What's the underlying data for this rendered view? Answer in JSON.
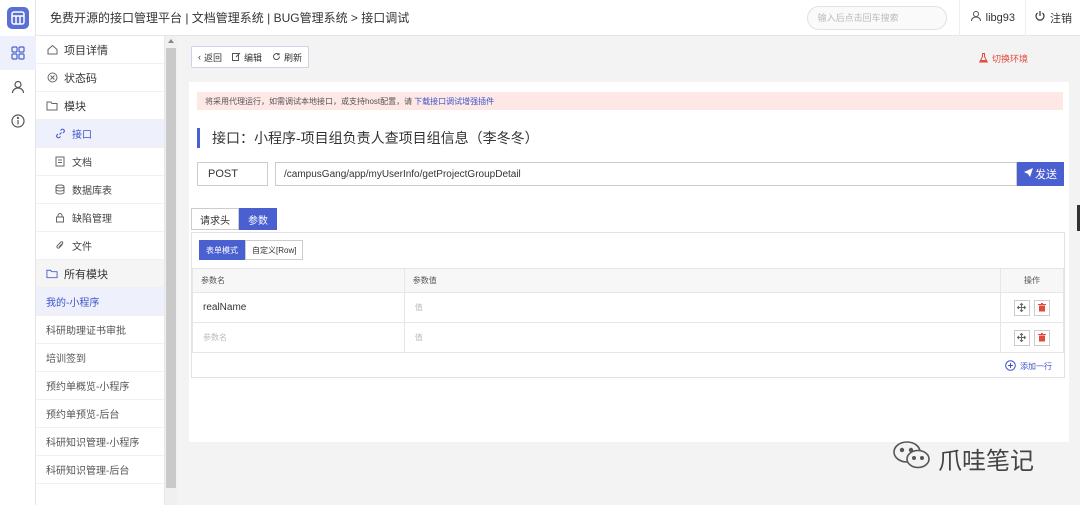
{
  "header": {
    "title": "免费开源的接口管理平台 | 文档管理系统 | BUG管理系统 > 接口调试",
    "search_placeholder": "输入后点击回车搜索",
    "username": "libg93",
    "logout": "注销"
  },
  "rail": {
    "icons": [
      "grid-icon",
      "user-icon",
      "info-icon"
    ]
  },
  "sidebar": {
    "items": [
      {
        "label": "项目详情"
      },
      {
        "label": "状态码"
      },
      {
        "label": "模块"
      },
      {
        "label": "接口"
      },
      {
        "label": "文档"
      },
      {
        "label": "数据库表"
      },
      {
        "label": "缺陷管理"
      },
      {
        "label": "文件"
      },
      {
        "label": "所有模块"
      }
    ],
    "modules": [
      {
        "label": "我的-小程序"
      },
      {
        "label": "科研助理证书审批"
      },
      {
        "label": "培训签到"
      },
      {
        "label": "预约单概览-小程序"
      },
      {
        "label": "预约单预览-后台"
      },
      {
        "label": "科研知识管理-小程序"
      },
      {
        "label": "科研知识管理-后台"
      }
    ]
  },
  "toolbar": {
    "back": "返回",
    "edit": "编辑",
    "refresh": "刷新",
    "switch_env": "切换环境"
  },
  "notice": {
    "text": "将采用代理运行，如需调试本地接口，或支持host配置，请",
    "link": "下载接口调试增强插件"
  },
  "api": {
    "title": "接口：小程序-项目组负责人查项目组信息（李冬冬）",
    "method": "POST",
    "url": "/campusGang/app/myUserInfo/getProjectGroupDetail",
    "send": "发送"
  },
  "tabs": [
    {
      "label": "请求头"
    },
    {
      "label": "参数"
    }
  ],
  "modes": [
    {
      "label": "表单模式"
    },
    {
      "label": "自定义[Row]"
    }
  ],
  "params": {
    "headers": {
      "name": "参数名",
      "value": "参数值",
      "op": "操作"
    },
    "rows": [
      {
        "name": "realName",
        "value_placeholder": "值"
      },
      {
        "name_placeholder": "参数名",
        "value_placeholder": "值"
      }
    ],
    "add_row": "添加一行"
  },
  "watermark": "爪哇笔记",
  "colors": {
    "accent": "#4a5fd0",
    "danger": "#e24a3b",
    "notice_bg": "#fde8e6"
  }
}
